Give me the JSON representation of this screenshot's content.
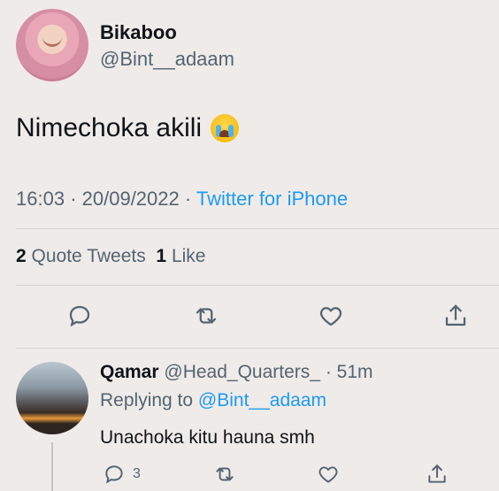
{
  "tweet": {
    "author_name": "Bikaboo",
    "author_handle": "@Bint__adaam",
    "text": "Nimechoka akili",
    "emoji": "loudly-crying-face",
    "time": "16:03",
    "date": "20/09/2022",
    "source": "Twitter for iPhone",
    "quote_count": "2",
    "quote_label": "Quote Tweets",
    "like_count": "1",
    "like_label": "Like"
  },
  "reply": {
    "author_name": "Qamar",
    "author_handle": "@Head_Quarters_",
    "age": "51m",
    "replying_prefix": "Replying to",
    "replying_to": "@Bint__adaam",
    "text": "Unachoka kitu hauna smh",
    "reply_count": "3"
  },
  "icons": [
    "reply-icon",
    "retweet-icon",
    "like-icon",
    "share-icon"
  ],
  "colors": {
    "link": "#1d9bf0",
    "secondary": "#536471",
    "primary": "#0f1419",
    "background": "#efebe9"
  }
}
